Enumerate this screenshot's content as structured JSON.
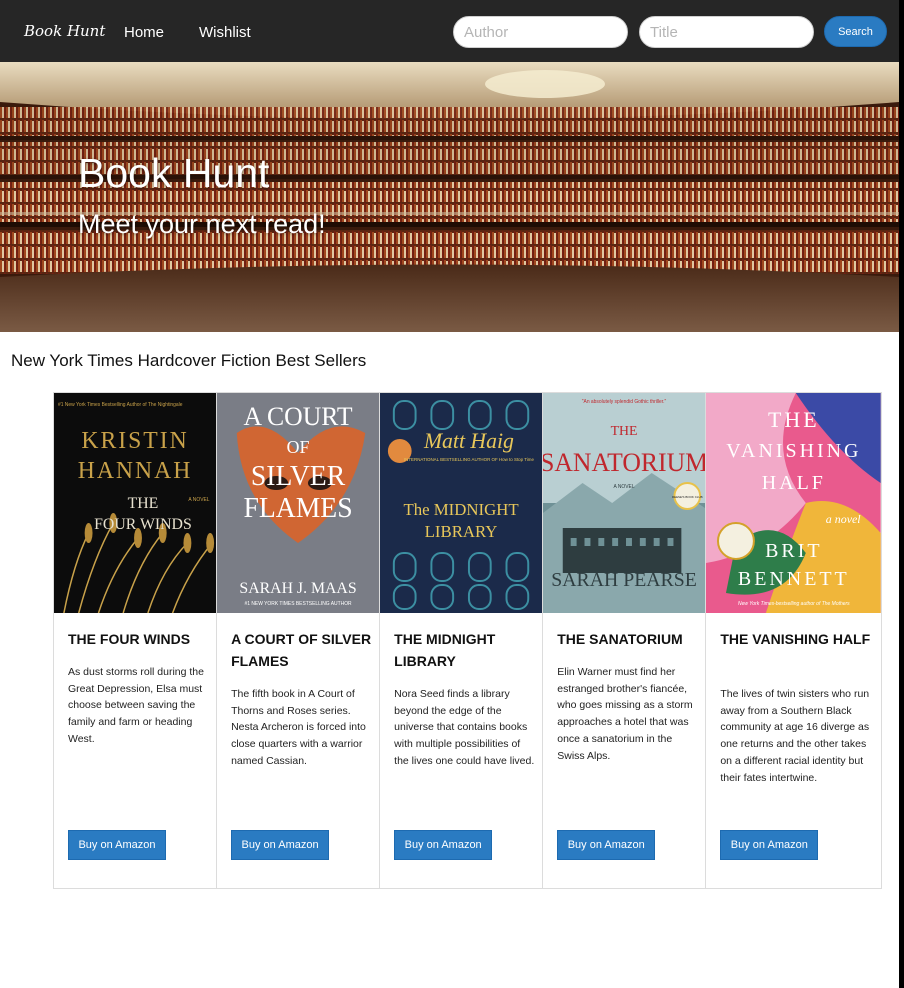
{
  "navbar": {
    "brand": "Book Hunt",
    "links": [
      "Home",
      "Wishlist"
    ],
    "author_placeholder": "Author",
    "title_placeholder": "Title",
    "search_label": "Search"
  },
  "hero": {
    "title": "Book Hunt",
    "subtitle": "Meet your next read!"
  },
  "section": {
    "title": "New York Times Hardcover Fiction Best Sellers"
  },
  "books": [
    {
      "title": "THE FOUR WINDS",
      "description": "As dust storms roll during the Great Depression, Elsa must choose between saving the family and farm or heading West.",
      "button": "Buy on Amazon",
      "cover": {
        "bg": "#0c0c0c",
        "accent": "#c9a24a",
        "topline": "#1 New York Times Bestselling Author of The Nightingale",
        "lines": [
          "KRISTIN",
          "HANNAH",
          "THE",
          "FOUR WINDS"
        ],
        "tag": "A NOVEL"
      }
    },
    {
      "title": "A COURT OF SILVER FLAMES",
      "description": "The fifth book in A Court of Thorns and Roses series. Nesta Archeron is forced into close quarters with a warrior named Cassian.",
      "button": "Buy on Amazon",
      "cover": {
        "bg": "#7a7d86",
        "accent": "#d9642a",
        "lines": [
          "A COURT",
          "OF",
          "SILVER",
          "FLAMES"
        ],
        "author": "SARAH J. MAAS",
        "footer": "#1 NEW YORK TIMES BESTSELLING AUTHOR"
      }
    },
    {
      "title": "THE MIDNIGHT LIBRARY",
      "description": "Nora Seed finds a library beyond the edge of the universe that contains books with multiple possibilities of the lives one could have lived.",
      "button": "Buy on Amazon",
      "cover": {
        "bg": "#1b2a4a",
        "accent": "#e8c75a",
        "author": "Matt Haig",
        "sub": "INTERNATIONAL BESTSELLING AUTHOR OF How to Stop Time",
        "lines": [
          "The MIDNIGHT",
          "LIBRARY"
        ]
      }
    },
    {
      "title": "THE SANATORIUM",
      "description": "Elin Warner must find her estranged brother's fiancée, who goes missing as a storm approaches a hotel that was once a sanatorium in the Swiss Alps.",
      "button": "Buy on Amazon",
      "cover": {
        "bg": "#6f9196",
        "accent": "#c0272d",
        "topline": "\"An absolutely splendid Gothic thriller.\"",
        "lines": [
          "THE",
          "SANATORIUM"
        ],
        "tag": "A NOVEL",
        "author": "SARAH PEARSE",
        "badge": "REESE'S BOOK CLUB"
      }
    },
    {
      "title": "THE VANISHING HALF",
      "description": "The lives of twin sisters who run away from a Southern Black community at age 16 diverge as one returns and the other takes on a different racial identity but their fates intertwine.",
      "button": "Buy on Amazon",
      "cover": {
        "bg": "#e95a8d",
        "accent": "#f0b63a",
        "lines": [
          "THE",
          "VANISHING",
          "HALF"
        ],
        "tag": "a novel",
        "author_lines": [
          "BRIT",
          "BENNETT"
        ],
        "footer": "New York Times-bestselling author of The Mothers"
      }
    }
  ]
}
